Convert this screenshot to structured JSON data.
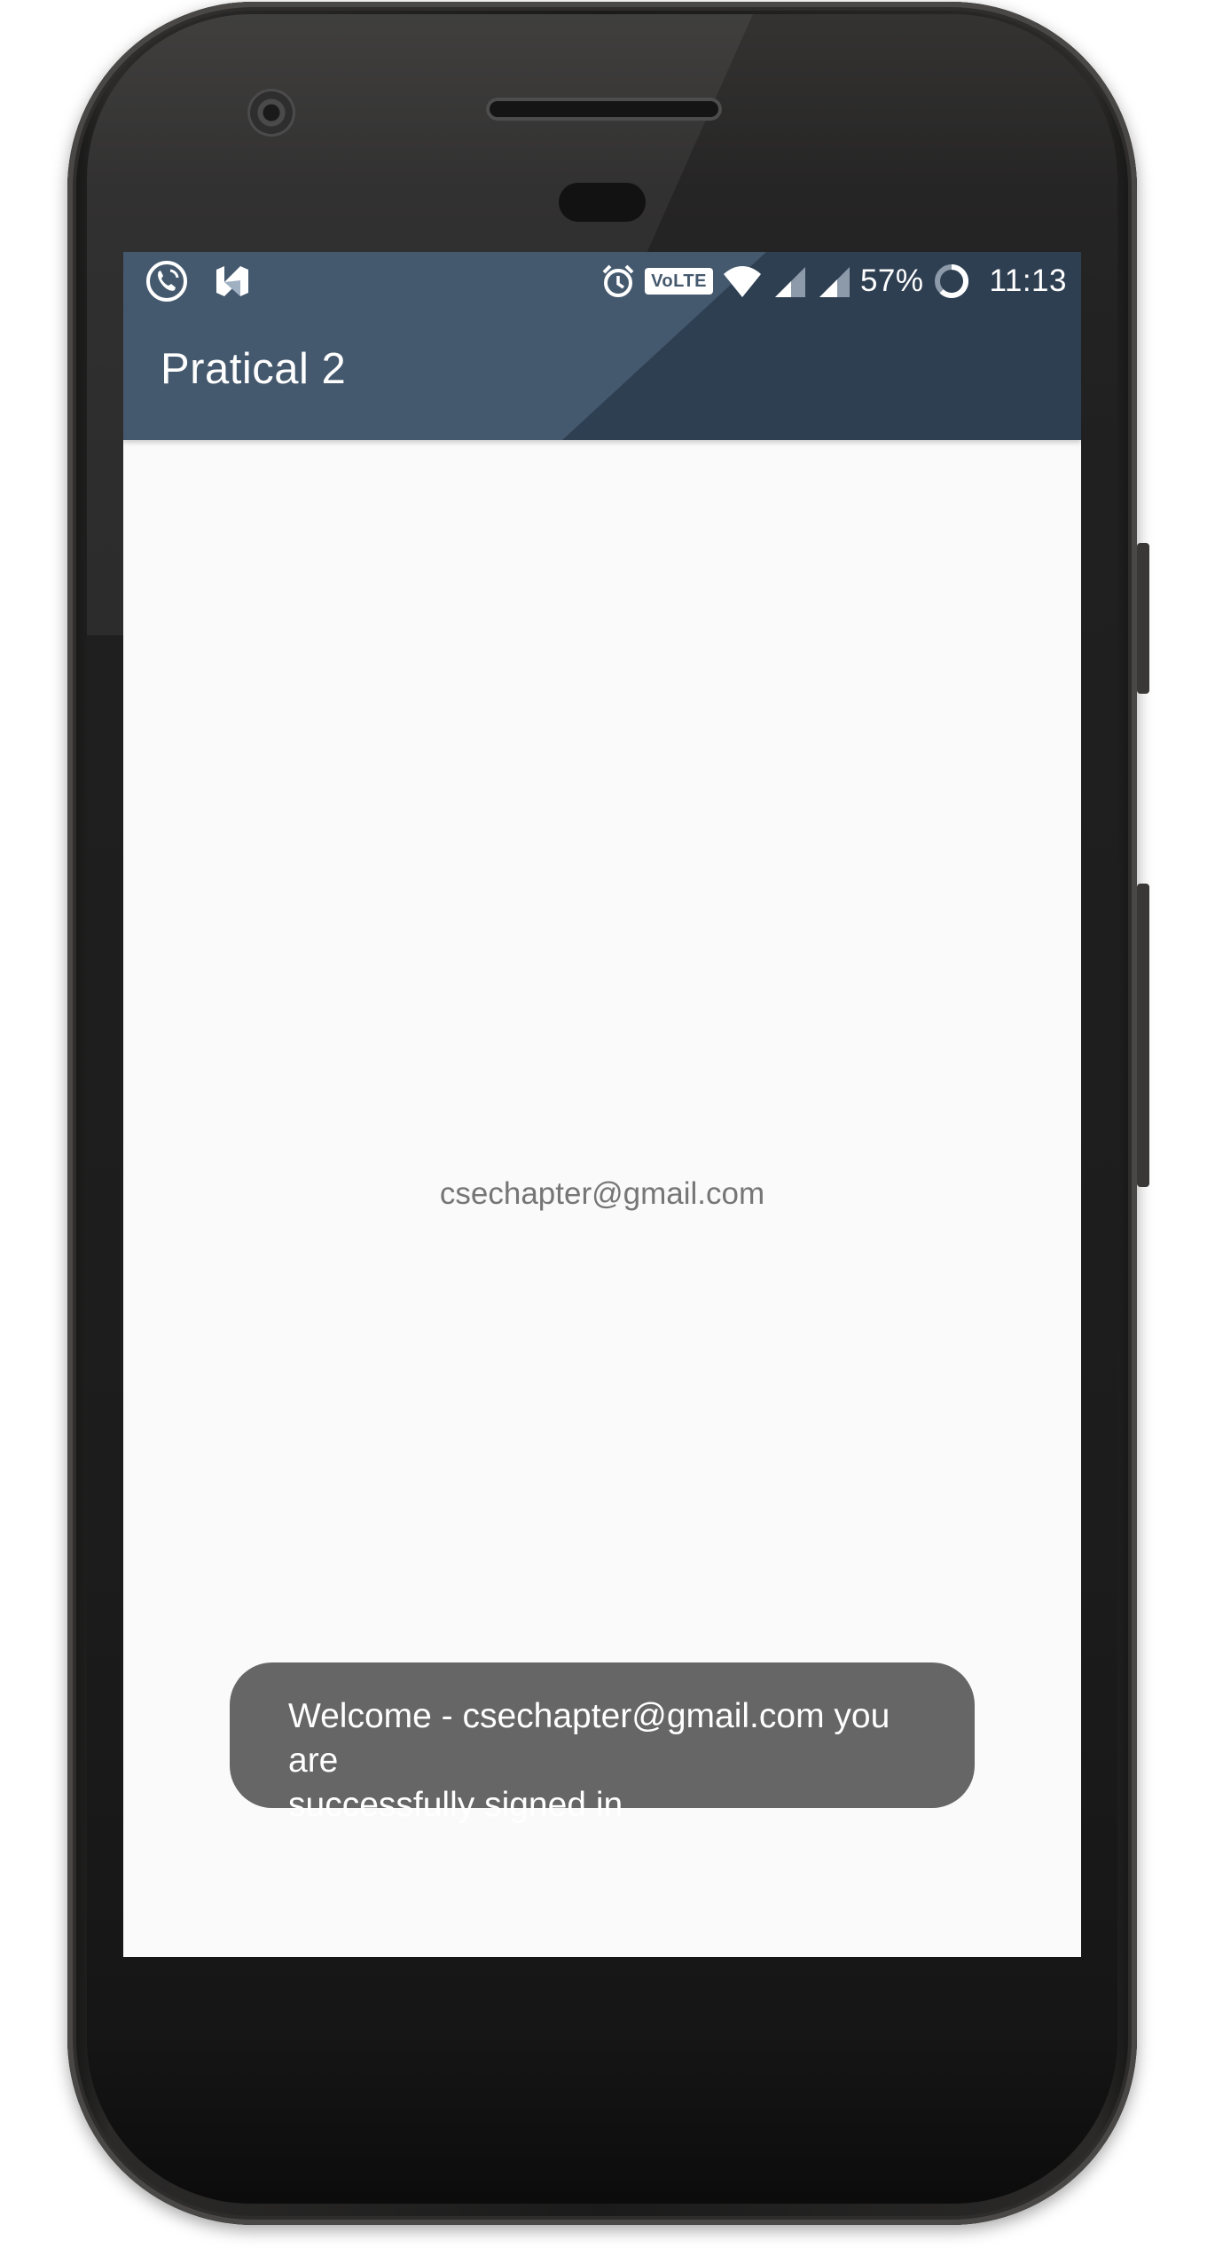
{
  "status_bar": {
    "left_icons": [
      "phone-call-icon",
      "n-letter-icon"
    ],
    "right_icons": [
      "alarm-icon",
      "volte-badge",
      "wifi-icon",
      "signal-icon",
      "signal-icon",
      "battery-ring-icon"
    ],
    "volte": "VoLTE",
    "battery": "57%",
    "time": "11:13"
  },
  "app_bar": {
    "title": "Pratical 2"
  },
  "content": {
    "email": "csechapter@gmail.com"
  },
  "toast": {
    "line1": "Welcome - csechapter@gmail.com you are",
    "line2": "successfully signed in"
  },
  "colors": {
    "toolbar": "#45596e",
    "toolbar_dark": "#2f3f52",
    "screen_bg": "#fafafa",
    "content_text": "#767676",
    "toast_bg": "#666666"
  }
}
